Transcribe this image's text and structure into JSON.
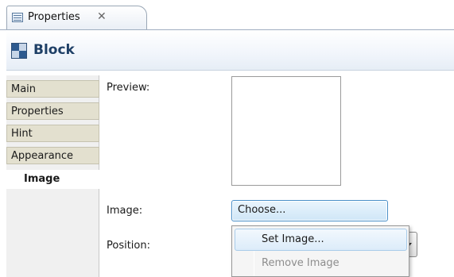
{
  "tab": {
    "label": "Properties",
    "close_glyph": "✕",
    "icon": "properties-icon"
  },
  "header": {
    "title": "Block",
    "icon": "block-icon"
  },
  "categories": [
    {
      "label": "Main",
      "active": false
    },
    {
      "label": "Properties",
      "active": false
    },
    {
      "label": "Hint",
      "active": false
    },
    {
      "label": "Appearance",
      "active": false
    },
    {
      "label": "Image",
      "active": true
    }
  ],
  "form": {
    "preview_label": "Preview:",
    "image_label": "Image:",
    "choose_button": "Choose...",
    "position_label": "Position:"
  },
  "menu": {
    "items": [
      {
        "label": "Set Image...",
        "enabled": true,
        "highlighted": true
      },
      {
        "label": "Remove Image",
        "enabled": false,
        "highlighted": false
      }
    ]
  },
  "colors": {
    "header_title": "#1e3f66",
    "category_bg": "#e3e0cf",
    "button_border": "#4a8fc8",
    "disabled_text": "#8d8d8d"
  }
}
